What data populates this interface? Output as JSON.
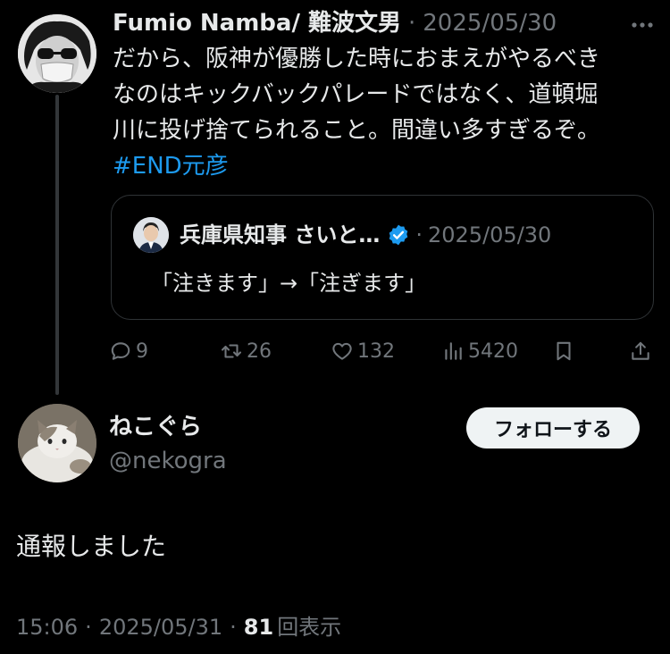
{
  "tweet": {
    "author_name": "Fumio Namba/ 難波文男",
    "separator": "·",
    "date": "2025/05/30",
    "body_lines": [
      "だから、阪神が優勝した時におまえがやるべき",
      "なのはキックバックパレードではなく、道頓堀",
      "川に投げ捨てられること。間違い多すぎるぞ。"
    ],
    "hashtag": "#END元彦",
    "more_icon": "more-horizontal-icon",
    "quote": {
      "author_name": "兵庫県知事 さいと…",
      "verified_icon": "verified-badge-icon",
      "verified_color": "#1d9bf0",
      "separator": "·",
      "date": "2025/05/30",
      "text": "「注きます」→「注ぎます」"
    },
    "actions": {
      "reply_count": "9",
      "retweet_count": "26",
      "like_count": "132",
      "view_count": "5420",
      "reply_icon": "reply-icon",
      "retweet_icon": "retweet-icon",
      "like_icon": "heart-icon",
      "views_icon": "views-icon",
      "bookmark_icon": "bookmark-icon",
      "share_icon": "share-icon"
    }
  },
  "reply": {
    "author_name": "ねこぐら",
    "handle": "@nekogra",
    "follow_label": "フォローする",
    "text": "通報しました",
    "meta": {
      "time": "15:06",
      "separator": "·",
      "date": "2025/05/31",
      "view_count": "81",
      "view_label": "回表示"
    }
  },
  "colors": {
    "background": "#000000",
    "text": "#e7e9ea",
    "muted": "#71767b",
    "link": "#1d9bf0",
    "follow_bg": "#eff3f4"
  }
}
